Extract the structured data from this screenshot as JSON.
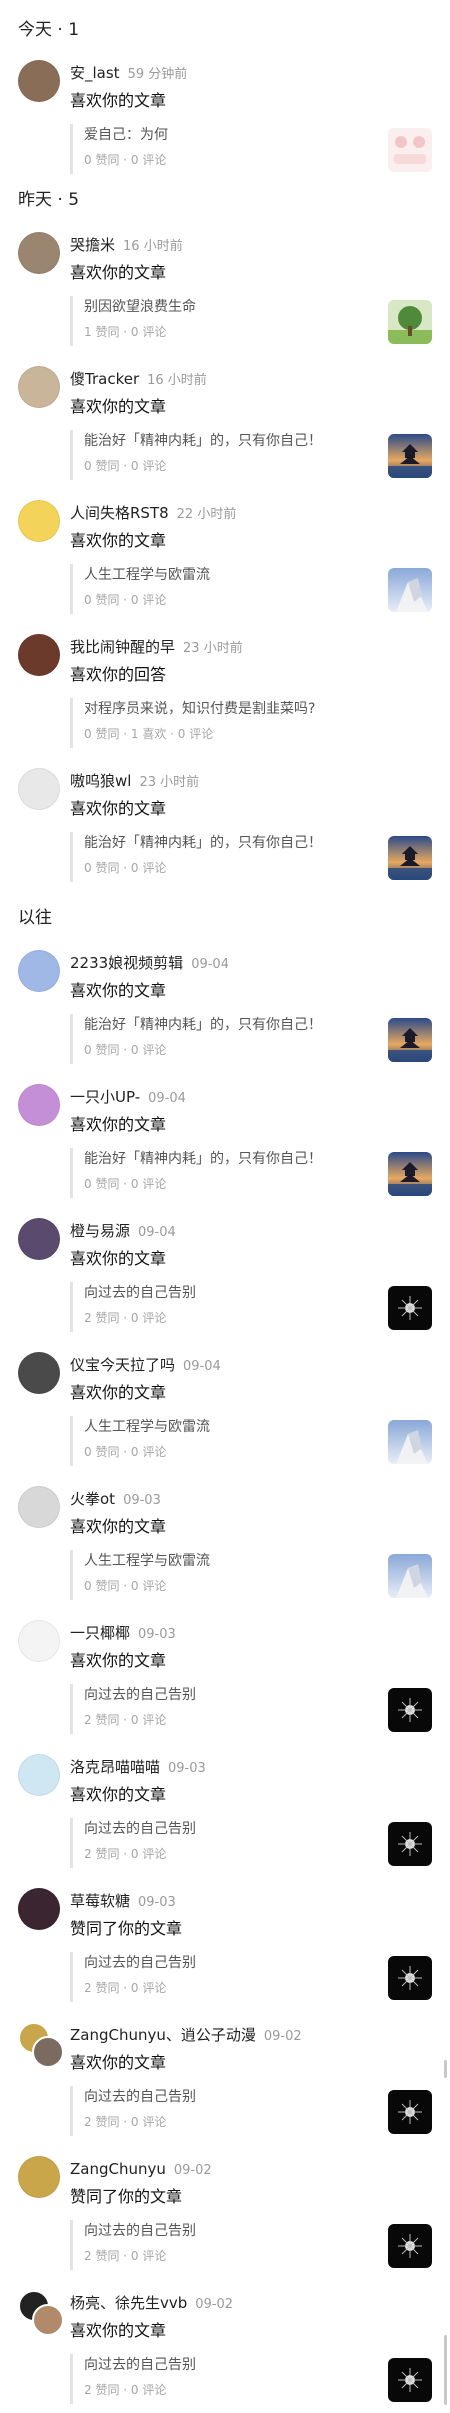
{
  "sections": [
    {
      "title": "今天 · 1",
      "items": [
        {
          "name": "安_last",
          "time": "59 分钟前",
          "action": "喜欢你的文章",
          "quote": "爱自己：为何",
          "stats": "0 赞同 · 0 评论",
          "avatar_color": "#8a6d57",
          "thumb": "pink"
        }
      ]
    },
    {
      "title": "昨天 · 5",
      "items": [
        {
          "name": "哭擔米",
          "time": "16 小时前",
          "action": "喜欢你的文章",
          "quote": "别因欲望浪费生命",
          "stats": "1 赞同 · 0 评论",
          "avatar_color": "#9a8570",
          "thumb": "tree"
        },
        {
          "name": "傻Tracker",
          "time": "16 小时前",
          "action": "喜欢你的文章",
          "quote": "能治好「精神内耗」的，只有你自己！",
          "stats": "0 赞同 · 0 评论",
          "avatar_color": "#c9b59a",
          "thumb": "pagoda"
        },
        {
          "name": "人间失格RST8",
          "time": "22 小时前",
          "action": "喜欢你的文章",
          "quote": "人生工程学与欧雷流",
          "stats": "0 赞同 · 0 评论",
          "avatar_color": "#f3d35a",
          "thumb": "sky"
        },
        {
          "name": "我比闹钟醒的早",
          "time": "23 小时前",
          "action": "喜欢你的回答",
          "quote": "对程序员来说，知识付费是割韭菜吗?",
          "stats": "0 赞同 · 1 喜欢 · 0 评论",
          "avatar_color": "#6b3a2a",
          "thumb": ""
        },
        {
          "name": "嗷呜狼wl",
          "time": "23 小时前",
          "action": "喜欢你的文章",
          "quote": "能治好「精神内耗」的，只有你自己！",
          "stats": "0 赞同 · 0 评论",
          "avatar_color": "#e8e8e8",
          "thumb": "pagoda"
        }
      ]
    },
    {
      "title": "以往",
      "items": [
        {
          "name": "2233娘视频剪辑",
          "time": "09-04",
          "action": "喜欢你的文章",
          "quote": "能治好「精神内耗」的，只有你自己！",
          "stats": "0 赞同 · 0 评论",
          "avatar_color": "#9fb8e6",
          "thumb": "pagoda"
        },
        {
          "name": "一只小UP-",
          "time": "09-04",
          "action": "喜欢你的文章",
          "quote": "能治好「精神内耗」的，只有你自己！",
          "stats": "0 赞同 · 0 评论",
          "avatar_color": "#c48fd6",
          "thumb": "pagoda"
        },
        {
          "name": "橙与易源",
          "time": "09-04",
          "action": "喜欢你的文章",
          "quote": "向过去的自己告别",
          "stats": "2 赞同 · 0 评论",
          "avatar_color": "#5a4a6e",
          "thumb": "dark"
        },
        {
          "name": "仪宝今天拉了吗",
          "time": "09-04",
          "action": "喜欢你的文章",
          "quote": "人生工程学与欧雷流",
          "stats": "0 赞同 · 0 评论",
          "avatar_color": "#4a4a4a",
          "thumb": "sky"
        },
        {
          "name": "火拳ot",
          "time": "09-03",
          "action": "喜欢你的文章",
          "quote": "人生工程学与欧雷流",
          "stats": "0 赞同 · 0 评论",
          "avatar_color": "#d8d8d8",
          "thumb": "sky"
        },
        {
          "name": "一只椰椰",
          "time": "09-03",
          "action": "喜欢你的文章",
          "quote": "向过去的自己告别",
          "stats": "2 赞同 · 0 评论",
          "avatar_color": "#f4f4f4",
          "thumb": "dark"
        },
        {
          "name": "洛克昂喵喵喵",
          "time": "09-03",
          "action": "喜欢你的文章",
          "quote": "向过去的自己告别",
          "stats": "2 赞同 · 0 评论",
          "avatar_color": "#cfe7f2",
          "thumb": "dark"
        },
        {
          "name": "草莓软糖",
          "time": "09-03",
          "action": "赞同了你的文章",
          "quote": "向过去的自己告别",
          "stats": "2 赞同 · 0 评论",
          "avatar_color": "#3a2530",
          "thumb": "dark"
        },
        {
          "name": "ZangChunyu、逍公子动漫",
          "time": "09-02",
          "action": "喜欢你的文章",
          "quote": "向过去的自己告别",
          "stats": "2 赞同 · 0 评论",
          "avatar_color": "#c9a64a",
          "avatar2_color": "#7a6a60",
          "thumb": "dark"
        },
        {
          "name": "ZangChunyu",
          "time": "09-02",
          "action": "赞同了你的文章",
          "quote": "向过去的自己告别",
          "stats": "2 赞同 · 0 评论",
          "avatar_color": "#c9a64a",
          "thumb": "dark"
        },
        {
          "name": "杨亮、徐先生vvb",
          "time": "09-02",
          "action": "喜欢你的文章",
          "quote": "向过去的自己告别",
          "stats": "2 赞同 · 0 评论",
          "avatar_color": "#222222",
          "avatar2_color": "#b08a6a",
          "thumb": "dark"
        }
      ]
    }
  ],
  "colors": {
    "accent": "#1a1a1a",
    "muted": "#9a9a9a",
    "quote_bar": "#e3e3e3"
  }
}
